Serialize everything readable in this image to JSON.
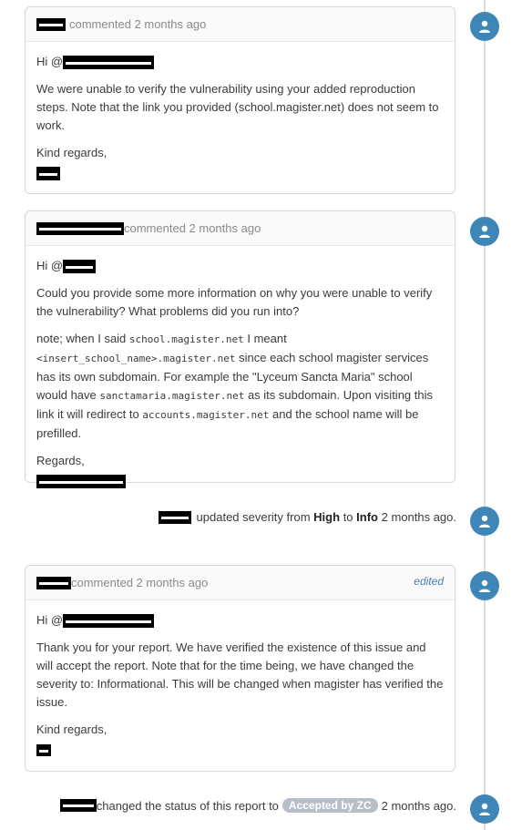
{
  "comments": [
    {
      "action": "commented 2 months ago",
      "greeting": "Hi @",
      "paragraphs": [
        "We were unable to verify the vulnerability using your added reproduction steps. Note that the link you provided (school.magister.net) does not seem to work."
      ],
      "closing": "Kind regards,"
    },
    {
      "action": "commented 2 months ago",
      "greeting": "Hi @",
      "paragraphs": [
        "Could you provide some more information on why you were unable to verify the vulnerability? What problems did you run into?"
      ],
      "note_parts": {
        "p1": "note; when I said ",
        "c1": "school.magister.net",
        "p2": " I meant ",
        "c2": "<insert_school_name>.magister.net",
        "p3": " since each school magister services has its own subdomain. For example the \"Lyceum Sancta Maria\" school would have ",
        "c3": "sanctamaria.magister.net",
        "p4": " as its subdomain. Upon visiting this link it will redirect to ",
        "c4": "accounts.magister.net",
        "p5": " and the school name will be prefilled."
      },
      "closing": "Regards,"
    },
    {
      "action": "commented 2 months ago",
      "edited_label": "edited",
      "greeting": "Hi @",
      "paragraphs": [
        "Thank you for your report. We have verified the existence of this issue and will accept the report. Note that for the time being, we have changed the severity to: Informational. This will be changed when magister has verified the issue."
      ],
      "closing": "Kind regards,"
    }
  ],
  "severity_event": {
    "prefix": "updated severity from",
    "from": "High",
    "to_word": "to",
    "to": "Info",
    "time": "2 months ago."
  },
  "status_event": {
    "prefix": "changed the status of this report to",
    "badge": "Accepted by ZC",
    "time": "2 months ago."
  },
  "colors": {
    "avatar": "#3e86b7",
    "link": "#4b7fb0",
    "badge": "#b7bec8"
  },
  "icons": {
    "avatar": "user-icon"
  }
}
